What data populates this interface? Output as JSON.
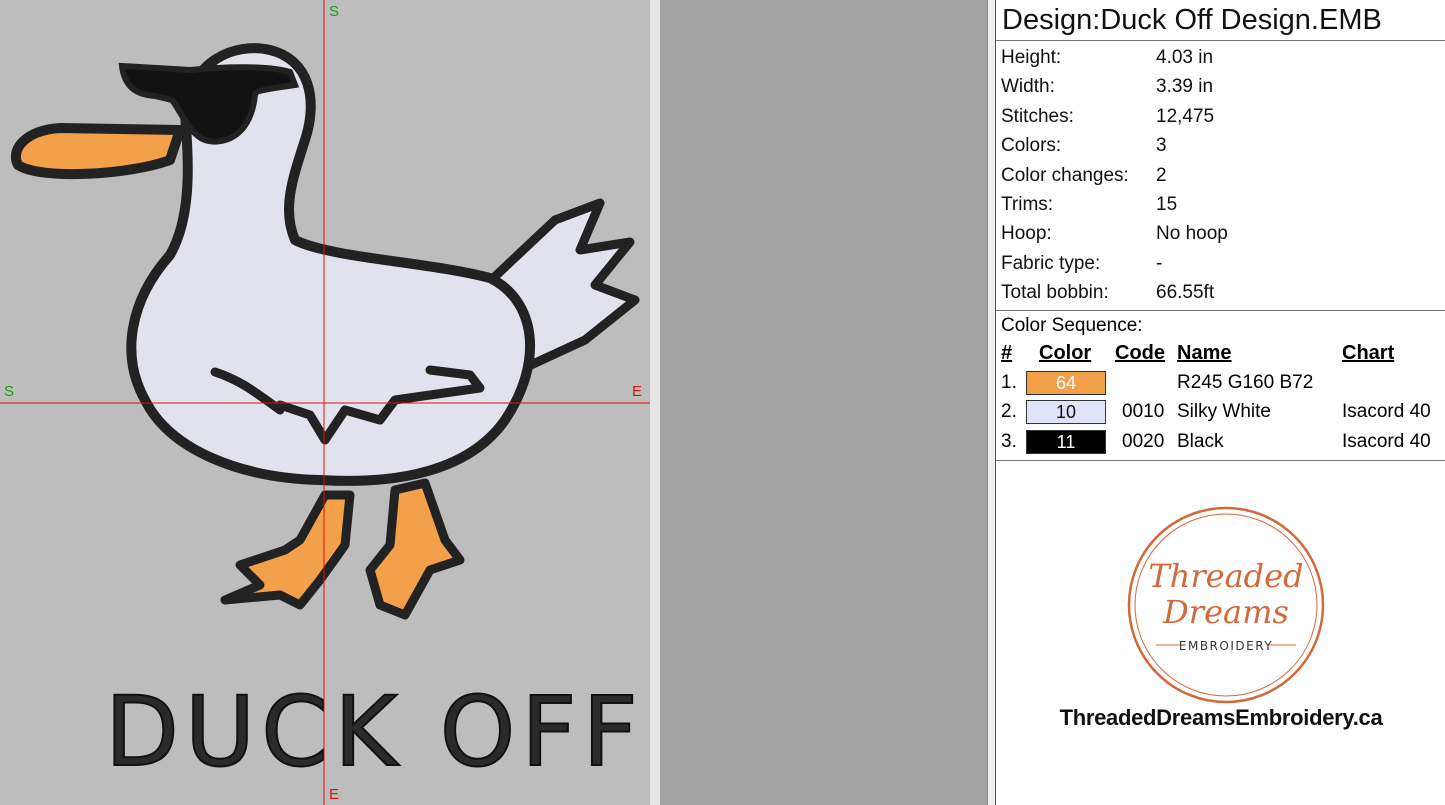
{
  "canvas": {
    "guide_labels": {
      "top": "S",
      "left": "S",
      "right": "E",
      "bottom": "E"
    },
    "text": "DUCK OFF",
    "colors": {
      "background": "#bdbdbd",
      "guide": "#e01010",
      "outline": "#222222",
      "body": "#e2e2ee",
      "beak": "#f3a04a",
      "glasses": "#111111",
      "guide_label_top": "#19a019"
    }
  },
  "info": {
    "title": "Design:Duck Off Design.EMB",
    "stats": [
      {
        "label": "Height:",
        "value": "4.03 in"
      },
      {
        "label": "Width:",
        "value": "3.39 in"
      },
      {
        "label": "Stitches:",
        "value": "12,475"
      },
      {
        "label": "Colors:",
        "value": "3"
      },
      {
        "label": "Color changes:",
        "value": "2"
      },
      {
        "label": "Trims:",
        "value": "15"
      },
      {
        "label": "Hoop:",
        "value": "No hoop"
      },
      {
        "label": "Fabric type:",
        "value": "-"
      },
      {
        "label": "Total bobbin:",
        "value": "66.55ft"
      }
    ],
    "color_sequence_title": "Color Sequence:",
    "headers": {
      "num": "#",
      "color": "Color",
      "code": "Code",
      "name": "Name",
      "chart": "Chart"
    },
    "colors": [
      {
        "num": "1.",
        "swatch_label": "64",
        "swatch_color": "#f3a04a",
        "swatch_text_color": "#ffffff",
        "code": "",
        "name": "R245 G160 B72",
        "chart": ""
      },
      {
        "num": "2.",
        "swatch_label": "10",
        "swatch_color": "#dde4f7",
        "swatch_text_color": "#111111",
        "code": "0010",
        "name": "Silky White",
        "chart": "Isacord 40"
      },
      {
        "num": "3.",
        "swatch_label": "11",
        "swatch_color": "#000000",
        "swatch_text_color": "#ffffff",
        "code": "0020",
        "name": "Black",
        "chart": "Isacord 40"
      }
    ]
  },
  "logo": {
    "line1": "Threaded",
    "line2": "Dreams",
    "line3": "EMBROIDERY",
    "website": "ThreadedDreamsEmbroidery.ca",
    "accent_color": "#d2693a"
  }
}
